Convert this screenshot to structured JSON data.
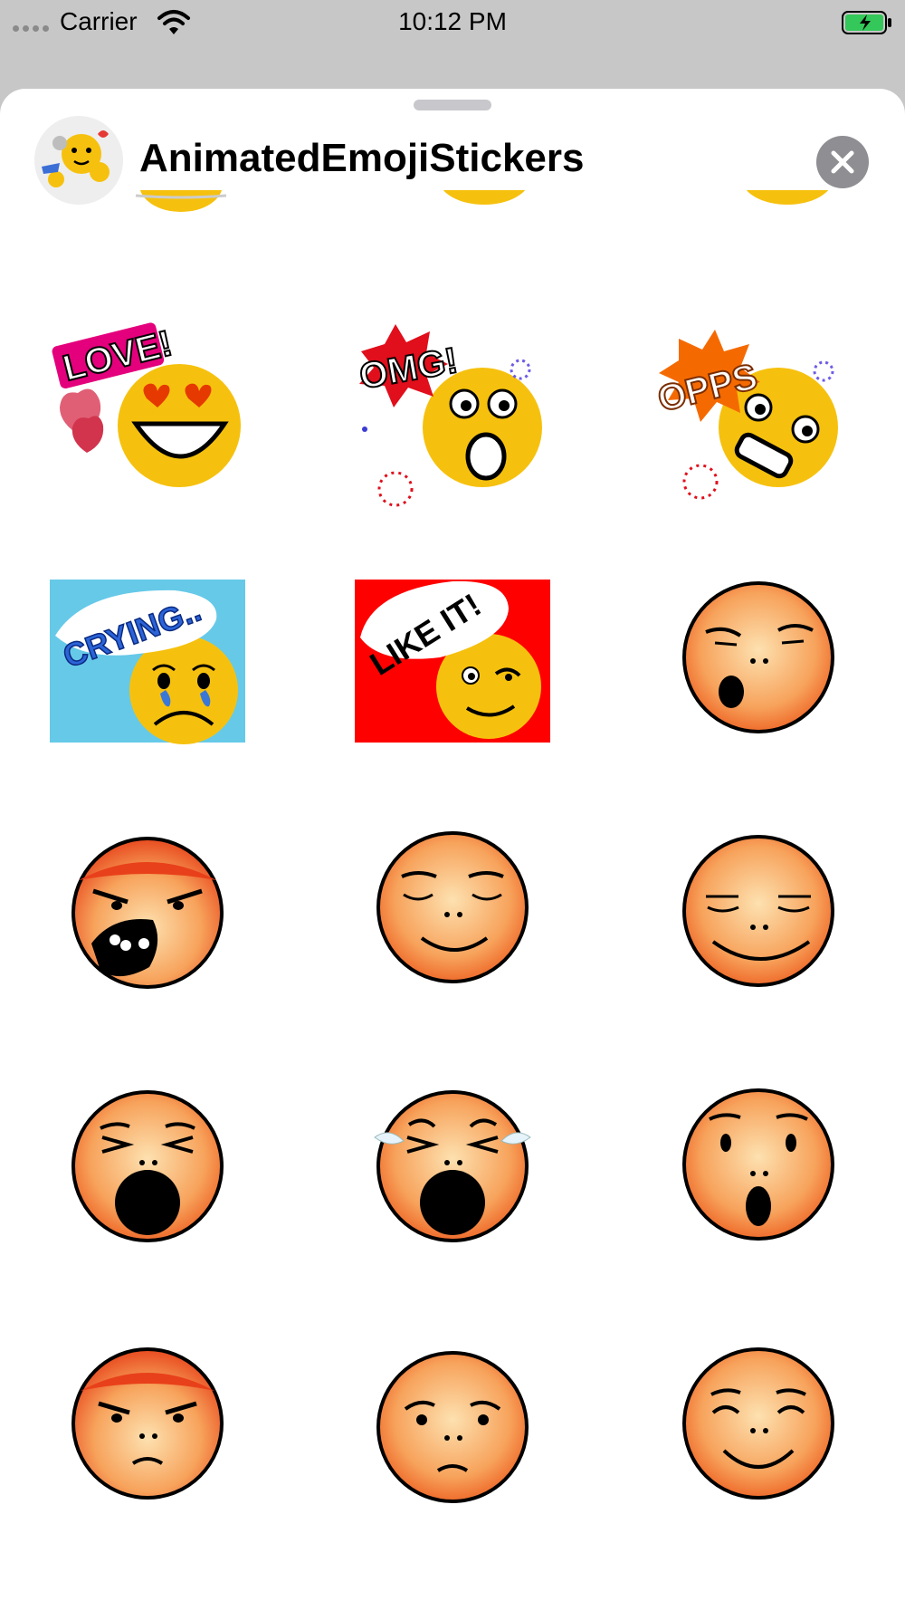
{
  "status_bar": {
    "carrier": "Carrier",
    "time": "10:12 PM",
    "battery_color": "#34c759"
  },
  "header": {
    "app_title": "AnimatedEmojiStickers",
    "close_icon": "close-x-icon"
  },
  "stickers": [
    {
      "name": "partial-top-1",
      "kind": "partial"
    },
    {
      "name": "partial-top-2",
      "kind": "partial"
    },
    {
      "name": "partial-top-3",
      "kind": "partial"
    },
    {
      "name": "love",
      "kind": "yellow",
      "caption": "LOVE!"
    },
    {
      "name": "omg",
      "kind": "yellow",
      "caption": "OMG!"
    },
    {
      "name": "opps",
      "kind": "yellow",
      "caption": "OPPS"
    },
    {
      "name": "crying",
      "kind": "yellow",
      "caption": "CRYING.."
    },
    {
      "name": "like-it",
      "kind": "yellow",
      "caption": "LIKE IT!"
    },
    {
      "name": "yawn",
      "kind": "orange"
    },
    {
      "name": "angry-shout",
      "kind": "orange"
    },
    {
      "name": "calm-smile",
      "kind": "orange"
    },
    {
      "name": "content",
      "kind": "orange"
    },
    {
      "name": "shout",
      "kind": "orange"
    },
    {
      "name": "crying-shout",
      "kind": "orange"
    },
    {
      "name": "surprised",
      "kind": "orange"
    },
    {
      "name": "angry-frown",
      "kind": "orange"
    },
    {
      "name": "worried",
      "kind": "orange"
    },
    {
      "name": "happy",
      "kind": "orange"
    }
  ]
}
